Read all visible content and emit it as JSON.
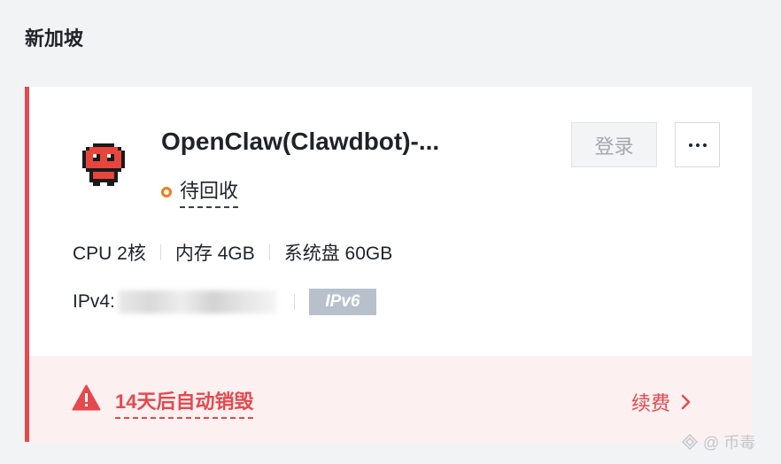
{
  "region": {
    "title": "新加坡"
  },
  "instance": {
    "name": "OpenClaw(Clawdbot)-...",
    "avatar_icon": "pixel-mascot-icon",
    "status": {
      "label": "待回收",
      "color": "#f07c1b"
    },
    "login_label": "登录",
    "more_icon": "more-dots-icon",
    "specs": [
      "CPU 2核",
      "内存 4GB",
      "系统盘 60GB"
    ],
    "ipv4_label": "IPv4:",
    "ipv6_badge": "IPv6"
  },
  "warning": {
    "icon": "warning-triangle-icon",
    "text": "14天后自动销毁",
    "renew_label": "续费",
    "color": "#e5484d"
  },
  "watermark": {
    "text": "@ 币毒"
  }
}
